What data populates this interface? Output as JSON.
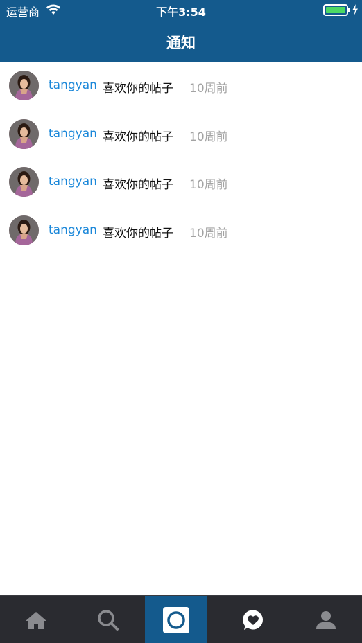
{
  "status": {
    "carrier": "运营商",
    "time": "下午3:54",
    "battery_level": 1.0,
    "battery_color": "#4cd964"
  },
  "nav": {
    "title": "通知"
  },
  "notifications": [
    {
      "user": "tangyan",
      "action": "喜欢你的帖子",
      "time": "10周前"
    },
    {
      "user": "tangyan",
      "action": "喜欢你的帖子",
      "time": "10周前"
    },
    {
      "user": "tangyan",
      "action": "喜欢你的帖子",
      "time": "10周前"
    },
    {
      "user": "tangyan",
      "action": "喜欢你的帖子",
      "time": "10周前"
    }
  ],
  "tabbar": {
    "items": [
      {
        "icon": "home-icon",
        "active": false
      },
      {
        "icon": "search-icon",
        "active": false
      },
      {
        "icon": "camera-icon",
        "active": true
      },
      {
        "icon": "heart-bubble-icon",
        "active": false
      },
      {
        "icon": "profile-icon",
        "active": false
      }
    ]
  },
  "colors": {
    "header": "#145a8d",
    "username": "#1a87d9",
    "timestamp": "#a3a3a3",
    "tabbar": "#2a2b30"
  }
}
